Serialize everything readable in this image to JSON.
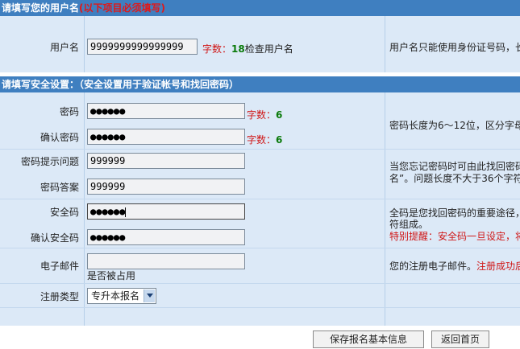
{
  "section_username": {
    "title": "请填写您的用户名",
    "required_note": "(以下项目必须填写)"
  },
  "username": {
    "label": "用户名",
    "value": "9999999999999999",
    "count_label": "字数：",
    "count": "18",
    "check_link": "检查用户名",
    "help": "用户名只能使用身份证号码，长"
  },
  "section_security": {
    "title": "请填写安全设置：（安全设置用于验证帐号和找回密码）"
  },
  "password": {
    "label": "密码",
    "value": "●●●●●●",
    "count_label": "字数：",
    "count": "6"
  },
  "confirm_password": {
    "label": "确认密码",
    "value": "●●●●●●",
    "count_label": "字数：",
    "count": "6"
  },
  "password_help": "密码长度为6～12位，区分字母",
  "hint_question": {
    "label": "密码提示问题",
    "value": "999999"
  },
  "hint_answer": {
    "label": "密码答案",
    "value": "999999"
  },
  "hint_help": {
    "line1": "当您忘记密码时可由此找回密码",
    "line2": "名”。问题长度不大于36个字符"
  },
  "security_code": {
    "label": "安全码",
    "value": "●●●●●●"
  },
  "confirm_security_code": {
    "label": "确认安全码",
    "value": "●●●●●●"
  },
  "security_help": {
    "line1": "全码是您找回密码的重要途径，",
    "line2": "符组成。",
    "warning": "特别提醒：安全码一旦设定，将"
  },
  "email": {
    "label": "电子邮件",
    "value": "",
    "status": "是否被占用",
    "help": "您的注册电子邮件。",
    "help_red": "注册成功后"
  },
  "reg_type": {
    "label": "注册类型",
    "selected": "专升本报名"
  },
  "buttons": {
    "save": "保存报名基本信息",
    "back": "返回首页"
  },
  "colors": {
    "header": "#3f7fc0",
    "panel": "#dce9f7",
    "required": "#e01818",
    "count_number": "#0a7a0a"
  }
}
